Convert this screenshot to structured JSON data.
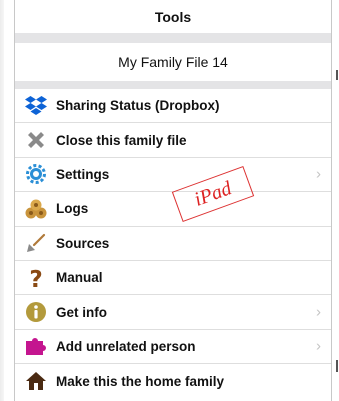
{
  "header": {
    "title": "Tools"
  },
  "family": {
    "name": "My Family File 14"
  },
  "menu": [
    {
      "label": "Sharing Status (Dropbox)",
      "icon": "dropbox-icon",
      "chevron": false
    },
    {
      "label": "Close this family file",
      "icon": "close-x-icon",
      "chevron": false
    },
    {
      "label": "Settings",
      "icon": "gear-icon",
      "chevron": true
    },
    {
      "label": "Logs",
      "icon": "logs-icon",
      "chevron": false
    },
    {
      "label": "Sources",
      "icon": "shovel-icon",
      "chevron": false
    },
    {
      "label": "Manual",
      "icon": "question-mark-icon",
      "chevron": false
    },
    {
      "label": "Get info",
      "icon": "info-icon",
      "chevron": true
    },
    {
      "label": "Add unrelated person",
      "icon": "puzzle-piece-icon",
      "chevron": true
    },
    {
      "label": "Make this the home family",
      "icon": "home-icon",
      "chevron": false
    }
  ],
  "chevron_glyph": "›",
  "watermark": "iPad",
  "colors": {
    "section_separator": "#e4e4e6",
    "watermark_red": "#d22222",
    "dropbox_blue": "#0d63d6",
    "settings_blue": "#2b8fd6",
    "info_olive": "#b39a3c",
    "puzzle_magenta": "#c4158f",
    "home_dark": "#4a2a12",
    "question_brown": "#8a4a14"
  }
}
